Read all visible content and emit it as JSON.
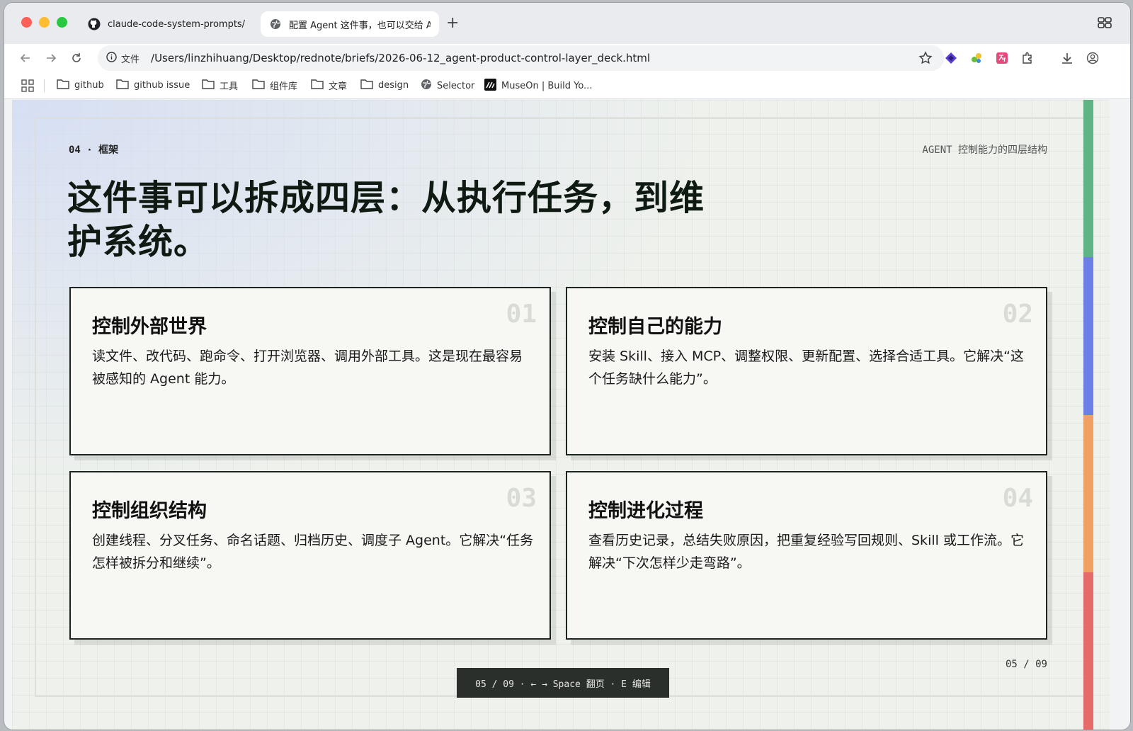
{
  "browser": {
    "tabs": [
      {
        "label": "claude-code-system-prompts/sys",
        "icon": "github-icon",
        "active": false
      },
      {
        "label": "配置 Agent 这件事，也可以交给 Ag",
        "icon": "globe-icon",
        "active": true
      }
    ],
    "new_tab": "+",
    "address": {
      "info_label": "文件",
      "url": "/Users/linzhihuang/Desktop/rednote/briefs/2026-06-12_agent-product-control-layer_deck.html"
    },
    "bookmarks": [
      {
        "label": "github",
        "icon": "folder-icon"
      },
      {
        "label": "github issue",
        "icon": "folder-icon"
      },
      {
        "label": "工具",
        "icon": "folder-icon"
      },
      {
        "label": "组件库",
        "icon": "folder-icon"
      },
      {
        "label": "文章",
        "icon": "folder-icon"
      },
      {
        "label": "design",
        "icon": "folder-icon"
      },
      {
        "label": "Selector",
        "icon": "globe-icon"
      },
      {
        "label": "MuseOn | Build Yo...",
        "icon": "museon-icon"
      }
    ]
  },
  "slide": {
    "eyebrow": "04 · 框架",
    "eyebrow_right": "AGENT 控制能力的四层结构",
    "headline_line1": "这件事可以拆成四层：从执行任务，到维",
    "headline_line2": "护系统。",
    "cards": [
      {
        "num": "01",
        "title": "控制外部世界",
        "body": "读文件、改代码、跑命令、打开浏览器、调用外部工具。这是现在最容易被感知的 Agent 能力。"
      },
      {
        "num": "02",
        "title": "控制自己的能力",
        "body": "安装 Skill、接入 MCP、调整权限、更新配置、选择合适工具。它解决“这个任务缺什么能力”。"
      },
      {
        "num": "03",
        "title": "控制组织结构",
        "body": "创建线程、分叉任务、命名话题、归档历史、调度子 Agent。它解决“任务怎样被拆分和继续”。"
      },
      {
        "num": "04",
        "title": "控制进化过程",
        "body": "查看历史记录，总结失败原因，把重复经验写回规则、Skill 或工作流。它解决“下次怎样少走弯路”。"
      }
    ],
    "page_count": "05 / 09",
    "hint": "05 / 09 · ← → Space 翻页 · E 编辑",
    "accent_colors": [
      "#5fb485",
      "#6b7fe6",
      "#f0a060",
      "#e66a6a"
    ]
  }
}
